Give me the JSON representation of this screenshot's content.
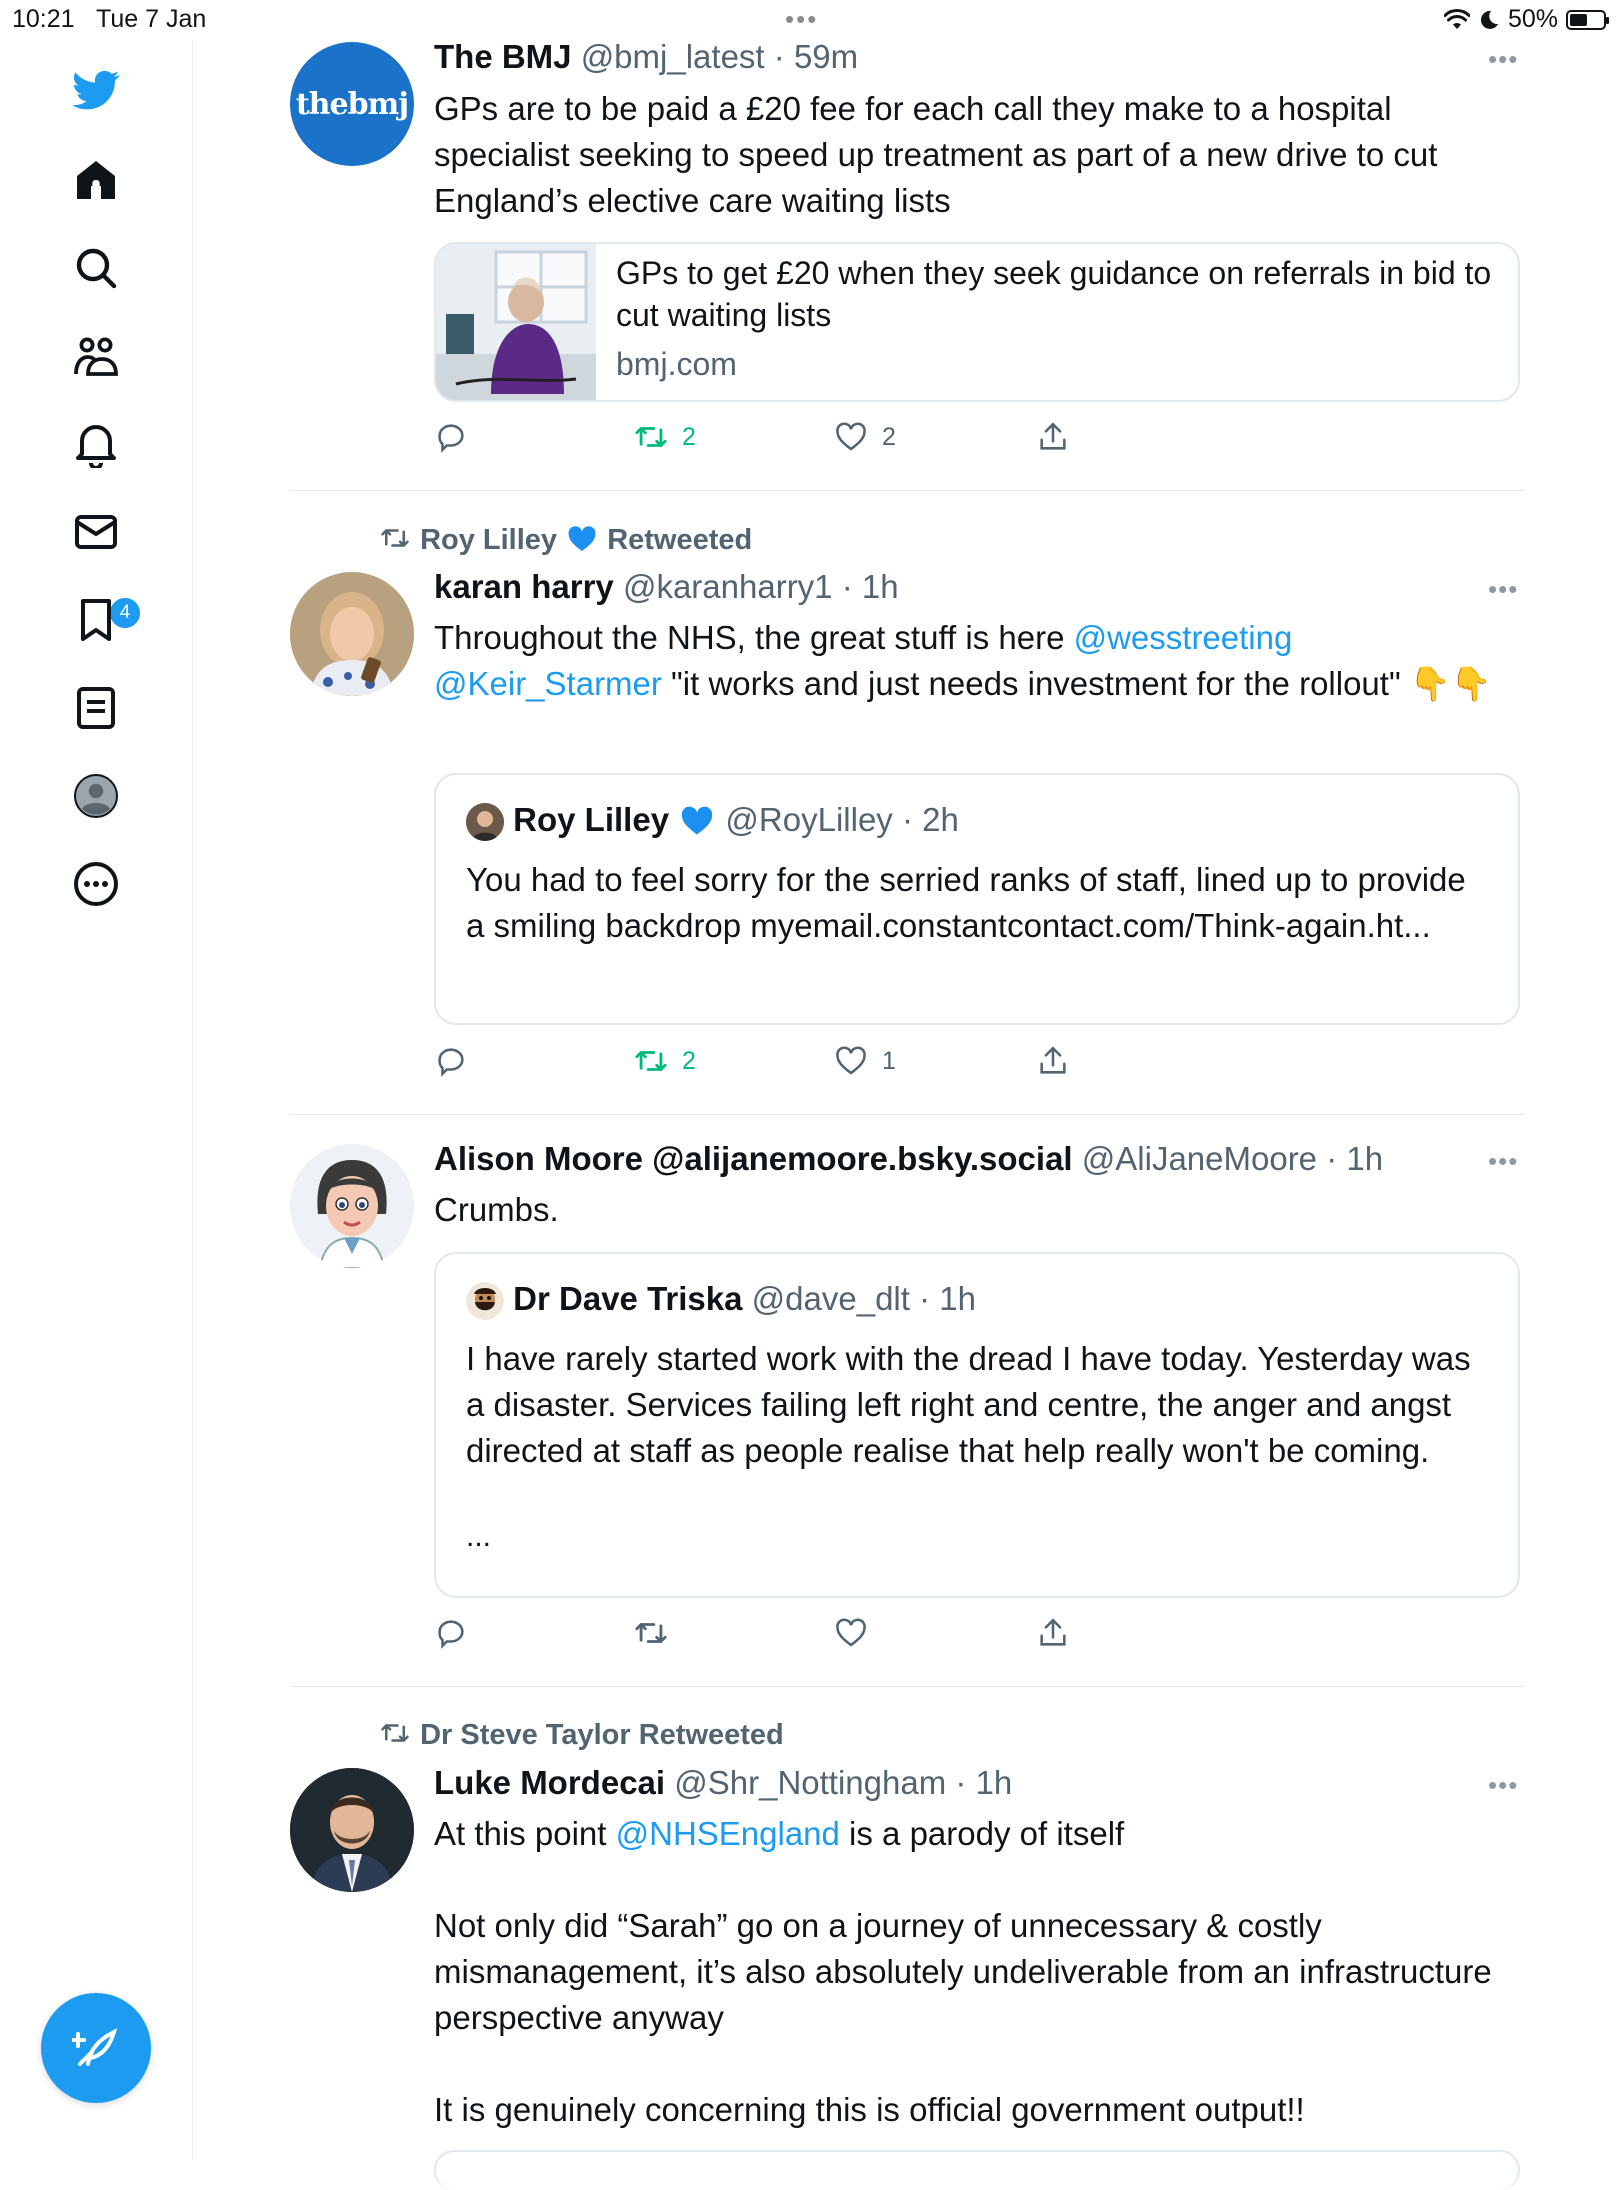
{
  "status_bar": {
    "time": "10:21",
    "date": "Tue 7 Jan",
    "dots": "•••",
    "battery": "50%",
    "battery_level": 0.5
  },
  "sidebar": {
    "items": [
      "twitter-logo",
      "home",
      "explore",
      "communities",
      "notifications",
      "messages",
      "bookmarks",
      "lists",
      "profile",
      "more"
    ],
    "notifications_badge": "4"
  },
  "tweets": [
    {
      "name": "The BMJ",
      "handle": "@bmj_latest",
      "time": "59m",
      "avatar_text": "thebmj",
      "text": "GPs are to be paid a £20 fee for each call they make to a hospital specialist seeking to speed up treatment as part of a new drive to cut England’s elective care waiting lists",
      "link_card": {
        "title": "GPs to get £20 when they seek guidance on referrals in bid to cut waiting lists",
        "domain": "bmj.com"
      },
      "retweets": "2",
      "likes": "2"
    },
    {
      "context": "Roy Lilley",
      "context_suffix": "Retweeted",
      "name": "karan harry",
      "handle": "@karanharry1",
      "time": "1h",
      "text_before": "Throughout the NHS, the great stuff is here ",
      "mention1": "@wesstreeting",
      "mention2": "@Keir_Starmer",
      "text_after": " \"it works and just needs investment for the rollout\" 👇👇",
      "quote": {
        "name": "Roy Lilley",
        "handle": "@RoyLilley",
        "time": "2h",
        "text": "You had to feel sorry for the serried ranks of staff, lined up to provide a smiling backdrop myemail.constantcontact.com/Think-again.ht..."
      },
      "retweets": "2",
      "likes": "1"
    },
    {
      "name": "Alison Moore @alijanemoore.bsky.social",
      "handle": "@AliJaneMoore",
      "time": "1h",
      "text": "Crumbs.",
      "quote": {
        "name": "Dr Dave Triska",
        "handle": "@dave_dlt",
        "time": "1h",
        "text": "I have rarely started work with the dread I have today. Yesterday was a disaster. Services failing left right and centre, the anger and angst directed at staff as people realise that help really won't be coming.",
        "ellipsis": "..."
      }
    },
    {
      "context": "Dr Steve Taylor Retweeted",
      "name": "Luke Mordecai",
      "handle": "@Shr_Nottingham",
      "time": "1h",
      "text_before": "At this point ",
      "mention": "@NHSEngland",
      "text_after": " is a parody of itself",
      "para2": "Not only did “Sarah” go on a journey of unnecessary & costly mismanagement, it’s also absolutely undeliverable from an infrastructure perspective anyway",
      "para3": "It is genuinely concerning this is official government output!!"
    }
  ],
  "ui": {
    "more_dots": "•••",
    "dot_sep": "·"
  },
  "colors": {
    "accent": "#1d9bf0",
    "retweet": "#00ba7c",
    "bmj": "#1565c0",
    "muted": "#536471"
  }
}
